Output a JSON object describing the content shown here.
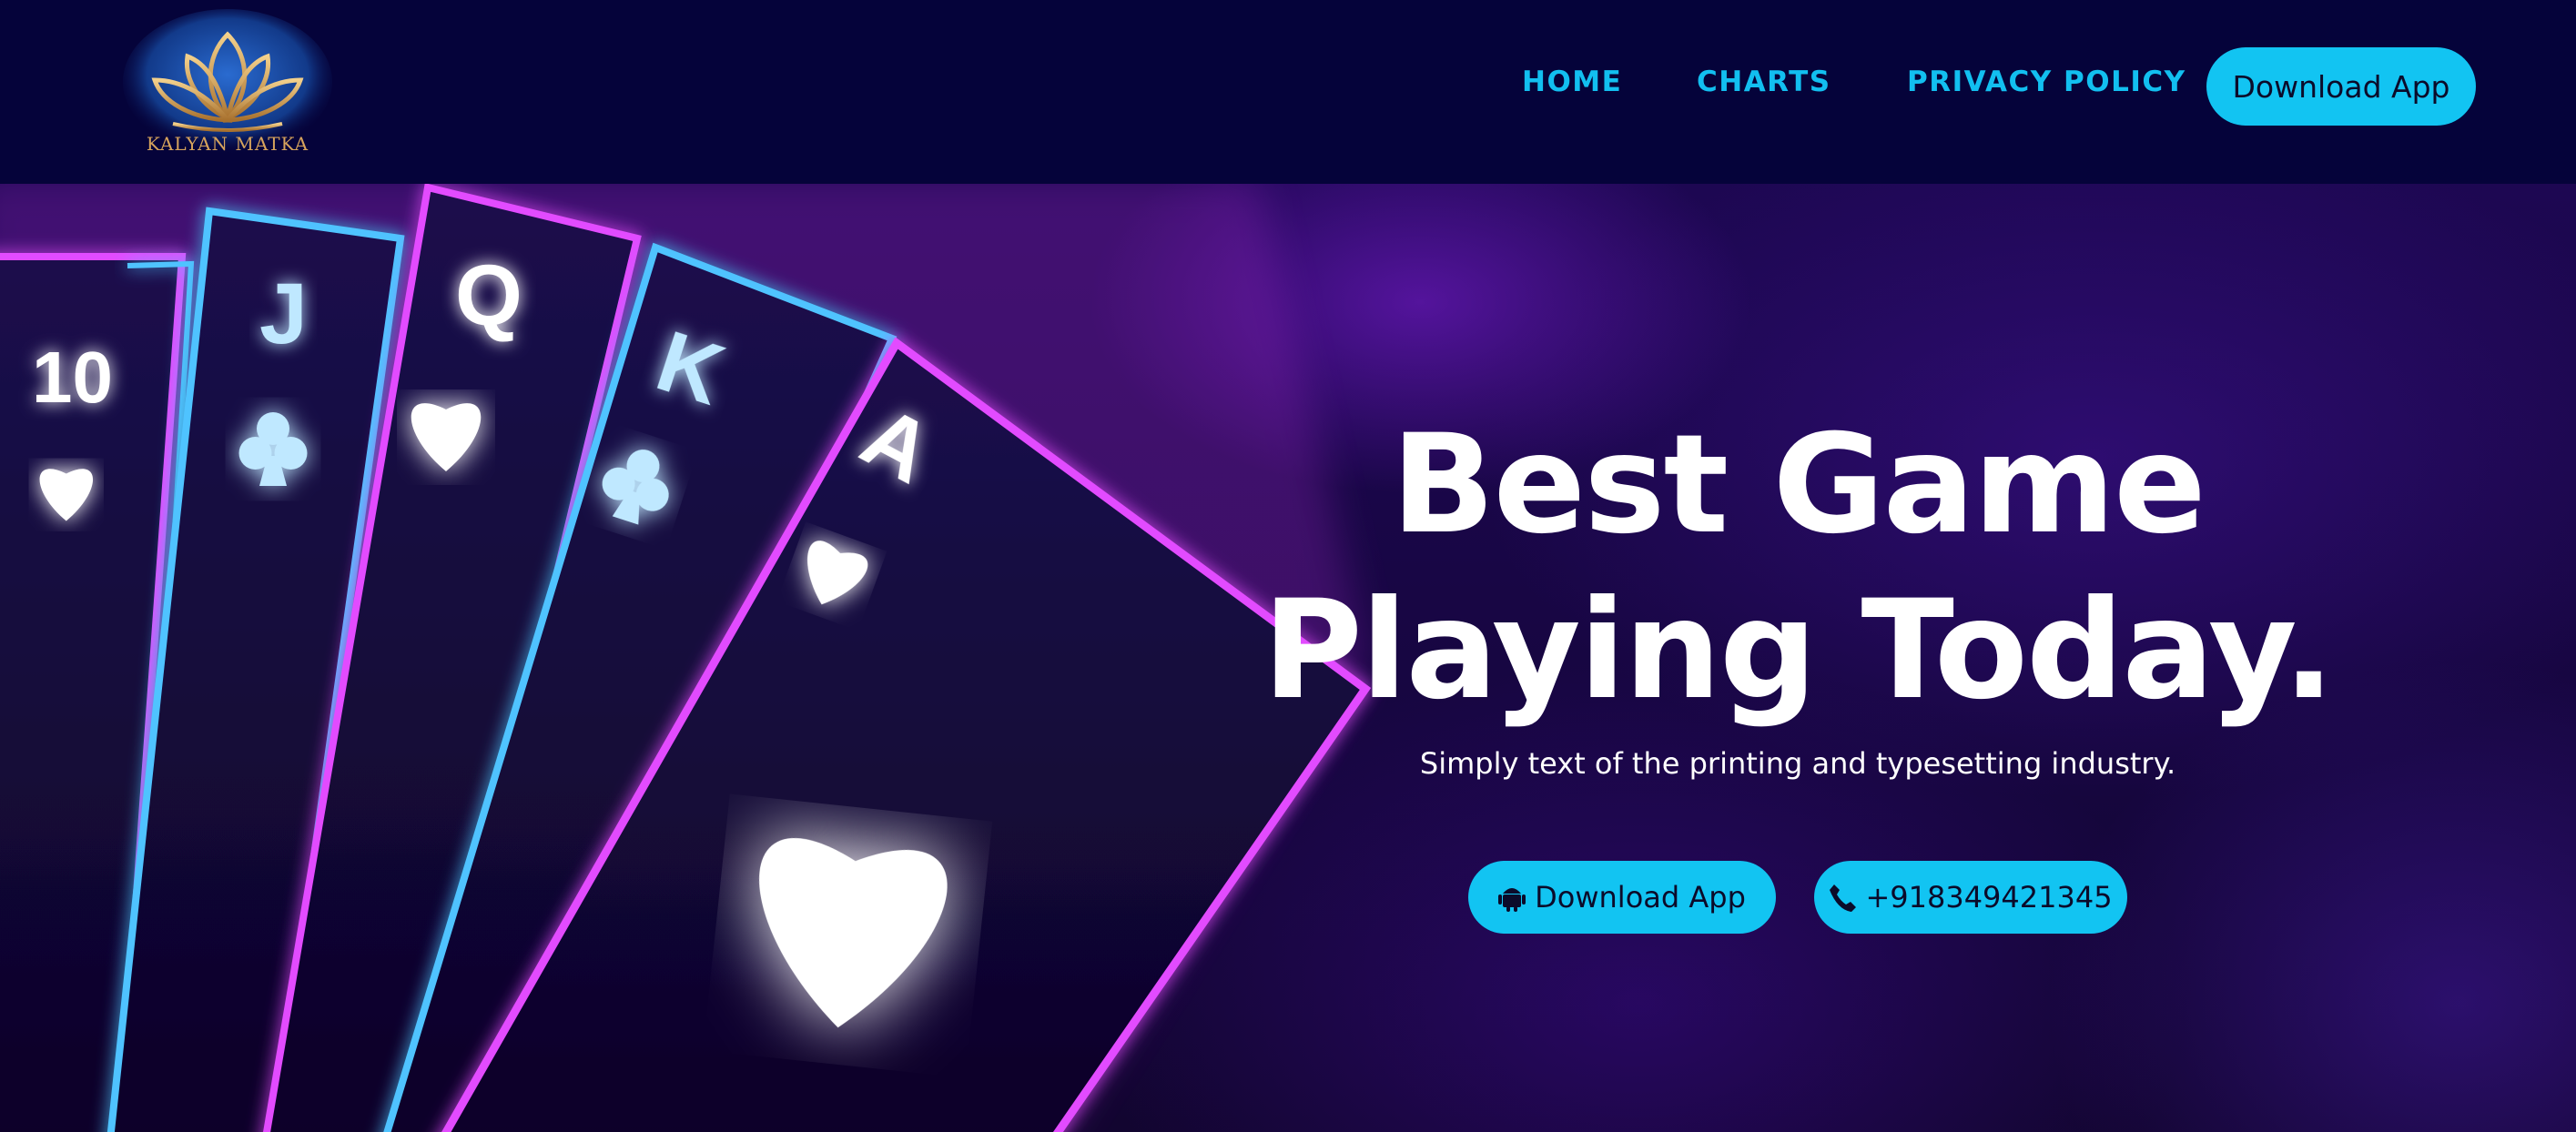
{
  "brand": {
    "logo_text": "KALYAN MATKA"
  },
  "nav": {
    "links": [
      "HOME",
      "CHARTS",
      "PRIVACY POLICY"
    ],
    "download_button": "Download App"
  },
  "hero": {
    "title_line1": "Best Game",
    "title_line2": "Playing Today.",
    "subtitle": "Simply text of the printing and typesetting industry.",
    "download_button": "Download App",
    "phone_button": "+918349421345",
    "cards": [
      "10",
      "J",
      "Q",
      "K",
      "A"
    ]
  },
  "colors": {
    "nav_bg": "#05033a",
    "accent": "#12c4f2",
    "nav_link": "#12bff0",
    "neon_pink": "#e24bff",
    "neon_blue": "#3fb7ff"
  },
  "icons": [
    "lotus-logo-icon",
    "android-icon",
    "phone-icon",
    "heart-suit-icon",
    "club-suit-icon"
  ]
}
